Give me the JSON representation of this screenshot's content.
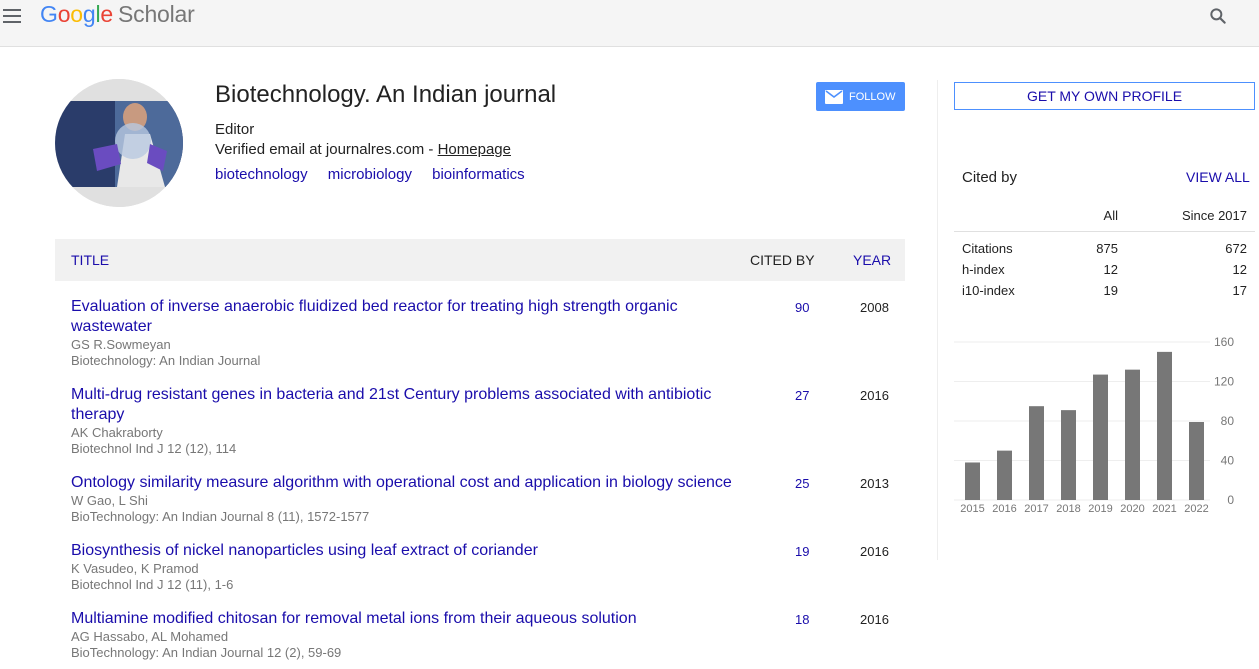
{
  "header": {
    "logo_google": [
      "G",
      "o",
      "o",
      "g",
      "l",
      "e"
    ],
    "logo_scholar": "Scholar"
  },
  "profile": {
    "name": "Biotechnology. An Indian journal",
    "role": "Editor",
    "email_text": "Verified email at journalres.com - ",
    "homepage_label": "Homepage",
    "interests": [
      "biotechnology",
      "microbiology",
      "bioinformatics"
    ],
    "follow_label": "FOLLOW"
  },
  "table": {
    "col_title": "TITLE",
    "col_cited": "CITED BY",
    "col_year": "YEAR",
    "rows": [
      {
        "title": "Evaluation of inverse anaerobic fluidized bed reactor for treating high strength organic wastewater",
        "authors": "GS R.Sowmeyan",
        "venue": "Biotechnology: An Indian Journal",
        "cited": "90",
        "year": "2008"
      },
      {
        "title": "Multi-drug resistant genes in bacteria and 21st Century problems associated with antibiotic therapy",
        "authors": "AK Chakraborty",
        "venue": "Biotechnol Ind J 12 (12), 114",
        "cited": "27",
        "year": "2016"
      },
      {
        "title": "Ontology similarity measure algorithm with operational cost and application in biology science",
        "authors": "W Gao, L Shi",
        "venue": "BioTechnology: An Indian Journal 8 (11), 1572-1577",
        "cited": "25",
        "year": "2013"
      },
      {
        "title": "Biosynthesis of nickel nanoparticles using leaf extract of coriander",
        "authors": "K Vasudeo, K Pramod",
        "venue": "Biotechnol Ind J 12 (11), 1-6",
        "cited": "19",
        "year": "2016"
      },
      {
        "title": "Multiamine modified chitosan for removal metal ions from their aqueous solution",
        "authors": "AG Hassabo, AL Mohamed",
        "venue": "BioTechnology: An Indian Journal 12 (2), 59-69",
        "cited": "18",
        "year": "2016"
      }
    ]
  },
  "sidebar": {
    "get_profile_label": "GET MY OWN PROFILE",
    "cited_by_label": "Cited by",
    "view_all_label": "VIEW ALL",
    "col_all": "All",
    "col_since": "Since 2017",
    "metrics": [
      {
        "label": "Citations",
        "all": "875",
        "since": "672"
      },
      {
        "label": "h-index",
        "all": "12",
        "since": "12"
      },
      {
        "label": "i10-index",
        "all": "19",
        "since": "17"
      }
    ]
  },
  "chart_data": {
    "type": "bar",
    "categories": [
      "2015",
      "2016",
      "2017",
      "2018",
      "2019",
      "2020",
      "2021",
      "2022"
    ],
    "values": [
      38,
      50,
      95,
      91,
      127,
      132,
      150,
      79
    ],
    "ylim": [
      0,
      160
    ],
    "yticks": [
      0,
      40,
      80,
      120,
      160
    ],
    "bar_color": "#777777",
    "grid": true
  }
}
